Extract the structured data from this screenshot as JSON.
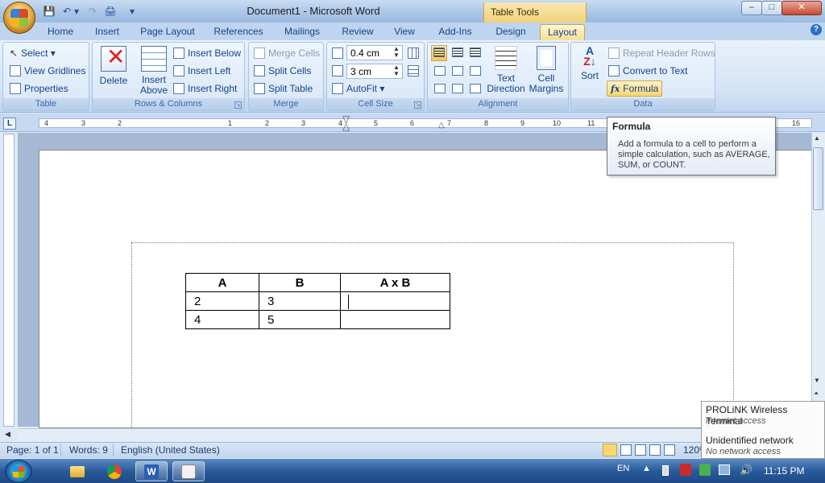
{
  "window": {
    "title": "Document1 - Microsoft Word",
    "contextual_group": "Table Tools",
    "controls": {
      "minimize": "–",
      "maximize": "□",
      "close": "✕"
    }
  },
  "qat": {
    "save": "💾",
    "undo": "↶",
    "redo": "↷",
    "print": "🖨",
    "customize": "▾"
  },
  "tabs": [
    {
      "label": "Home"
    },
    {
      "label": "Insert"
    },
    {
      "label": "Page Layout"
    },
    {
      "label": "References"
    },
    {
      "label": "Mailings"
    },
    {
      "label": "Review"
    },
    {
      "label": "View"
    },
    {
      "label": "Add-Ins"
    },
    {
      "label": "Design"
    },
    {
      "label": "Layout"
    }
  ],
  "help_icon": "?",
  "ribbon": {
    "table": {
      "label": "Table",
      "select": "Select ▾",
      "view_gridlines": "View Gridlines",
      "properties": "Properties"
    },
    "rows_columns": {
      "label": "Rows & Columns",
      "delete": "Delete",
      "insert_above": "Insert Above",
      "insert_below": "Insert Below",
      "insert_left": "Insert Left",
      "insert_right": "Insert Right"
    },
    "merge": {
      "label": "Merge",
      "merge_cells": "Merge Cells",
      "split_cells": "Split Cells",
      "split_table": "Split Table"
    },
    "cell_size": {
      "label": "Cell Size",
      "height": "0.4 cm",
      "width": "3 cm",
      "autofit": "AutoFit ▾"
    },
    "alignment": {
      "label": "Alignment",
      "text_direction": "Text Direction",
      "cell_margins": "Cell Margins"
    },
    "data": {
      "label": "Data",
      "sort": "Sort",
      "repeat_header_rows": "Repeat Header Rows",
      "convert_to_text": "Convert to Text",
      "formula": "Formula"
    }
  },
  "ruler": {
    "corner": "L",
    "ticks": [
      "4",
      "3",
      "2",
      "1",
      "1",
      "2",
      "3",
      "4",
      "5",
      "6",
      "7",
      "8",
      "9",
      "10",
      "11",
      "16"
    ]
  },
  "tooltip": {
    "title": "Formula",
    "body": "Add a formula to a cell to perform a simple calculation, such as AVERAGE, SUM, or COUNT."
  },
  "table": {
    "headers": [
      "A",
      "B",
      "A x B"
    ],
    "rows": [
      [
        "2",
        "3",
        ""
      ],
      [
        "4",
        "5",
        ""
      ]
    ]
  },
  "status": {
    "page": "Page: 1 of 1",
    "words": "Words: 9",
    "language": "English (United States)",
    "zoom": "120%"
  },
  "network_popup": {
    "name1": "PROLiNK Wireless Terminal",
    "status1": "Internet access",
    "name2": "Unidentified network",
    "status2": "No network access"
  },
  "taskbar": {
    "language": "EN",
    "time": "11:15 PM"
  }
}
